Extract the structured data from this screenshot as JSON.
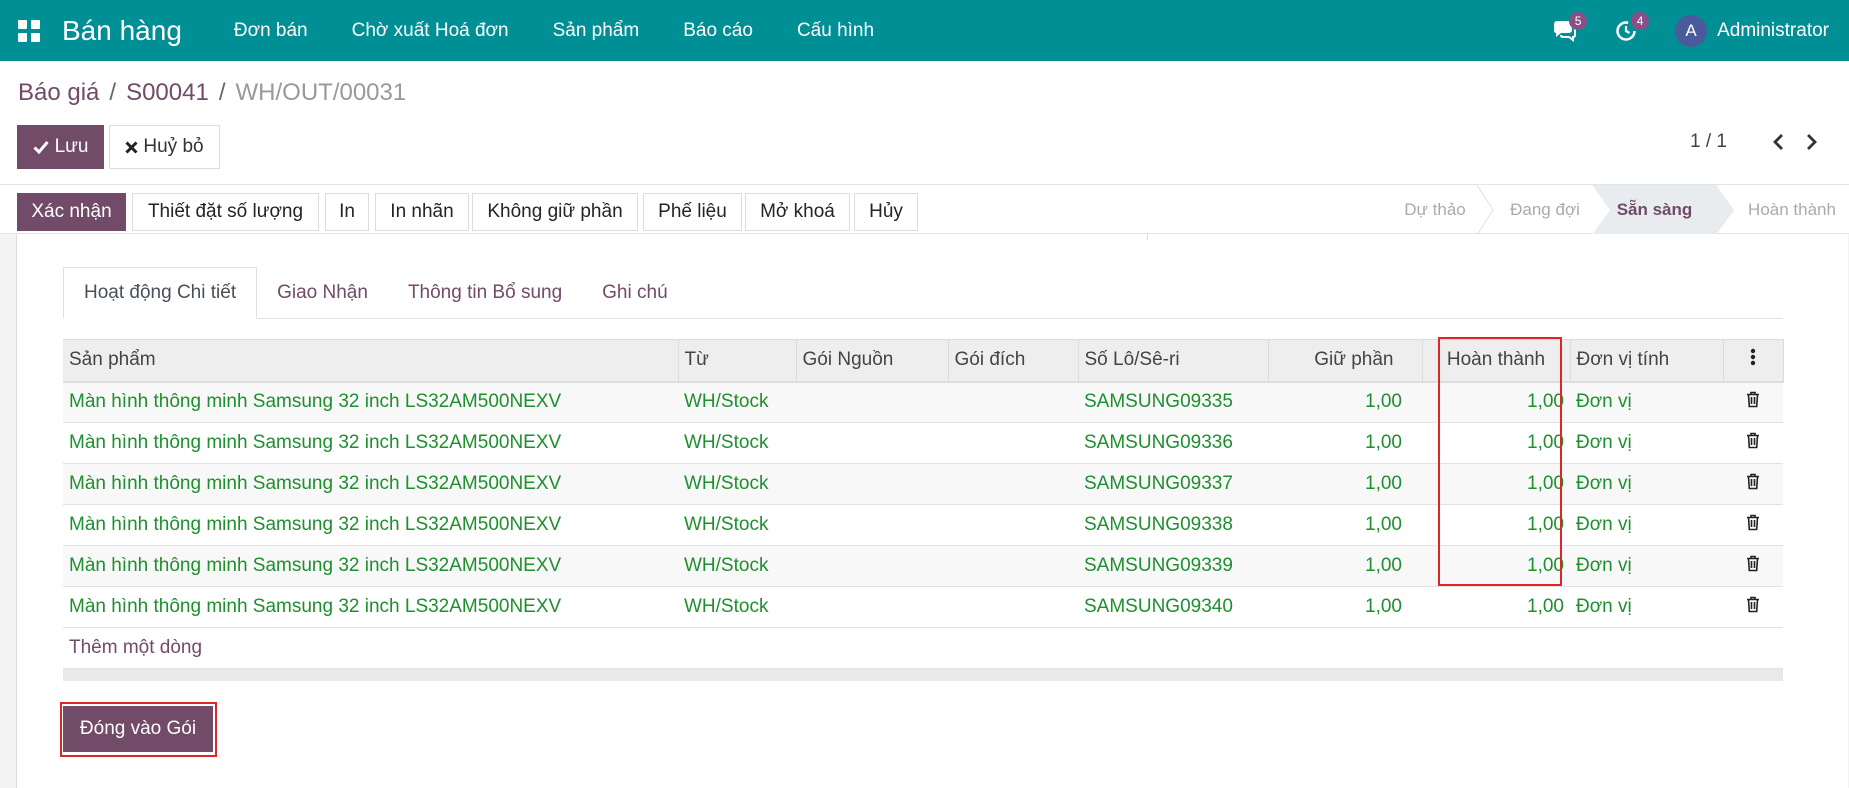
{
  "navbar": {
    "app_title": "Bán hàng",
    "menu": [
      "Đơn bán",
      "Chờ xuất Hoá đơn",
      "Sản phẩm",
      "Báo cáo",
      "Cấu hình"
    ],
    "messages_count": "5",
    "activities_count": "4",
    "user_initial": "A",
    "user_name": "Administrator"
  },
  "breadcrumb": {
    "items": [
      "Báo giá",
      "S00041"
    ],
    "current": "WH/OUT/00031",
    "separator": "/"
  },
  "control": {
    "save_label": "Lưu",
    "discard_label": "Huỷ bỏ",
    "pager_value": "1 / 1"
  },
  "statusbar": {
    "actions": [
      "Xác nhận",
      "Thiết đặt số lượng",
      "In",
      "In nhãn",
      "Không giữ phần",
      "Phế liệu",
      "Mở khoá",
      "Hủy"
    ],
    "stages": [
      "Dự thảo",
      "Đang đợi",
      "Sẵn sàng",
      "Hoàn thành"
    ],
    "active_stage": "Sẵn sàng"
  },
  "tabs": [
    "Hoạt động Chi tiết",
    "Giao Nhận",
    "Thông tin Bổ sung",
    "Ghi chú"
  ],
  "table": {
    "columns": [
      "Sản phẩm",
      "Từ",
      "Gói Nguồn",
      "Gói đích",
      "Số Lô/Sê-ri",
      "Giữ phần",
      "Hoàn thành",
      "Đơn vị tính"
    ],
    "rows": [
      {
        "product": "Màn hình thông minh Samsung 32 inch LS32AM500NEXV",
        "from": "WH/Stock",
        "source_pkg": "",
        "dest_pkg": "",
        "lot": "SAMSUNG09335",
        "reserved": "1,00",
        "done": "1,00",
        "uom": "Đơn vị"
      },
      {
        "product": "Màn hình thông minh Samsung 32 inch LS32AM500NEXV",
        "from": "WH/Stock",
        "source_pkg": "",
        "dest_pkg": "",
        "lot": "SAMSUNG09336",
        "reserved": "1,00",
        "done": "1,00",
        "uom": "Đơn vị"
      },
      {
        "product": "Màn hình thông minh Samsung 32 inch LS32AM500NEXV",
        "from": "WH/Stock",
        "source_pkg": "",
        "dest_pkg": "",
        "lot": "SAMSUNG09337",
        "reserved": "1,00",
        "done": "1,00",
        "uom": "Đơn vị"
      },
      {
        "product": "Màn hình thông minh Samsung 32 inch LS32AM500NEXV",
        "from": "WH/Stock",
        "source_pkg": "",
        "dest_pkg": "",
        "lot": "SAMSUNG09338",
        "reserved": "1,00",
        "done": "1,00",
        "uom": "Đơn vị"
      },
      {
        "product": "Màn hình thông minh Samsung 32 inch LS32AM500NEXV",
        "from": "WH/Stock",
        "source_pkg": "",
        "dest_pkg": "",
        "lot": "SAMSUNG09339",
        "reserved": "1,00",
        "done": "1,00",
        "uom": "Đơn vị"
      },
      {
        "product": "Màn hình thông minh Samsung 32 inch LS32AM500NEXV",
        "from": "WH/Stock",
        "source_pkg": "",
        "dest_pkg": "",
        "lot": "SAMSUNG09340",
        "reserved": "1,00",
        "done": "1,00",
        "uom": "Đơn vị"
      }
    ],
    "add_line_label": "Thêm một dòng"
  },
  "put_in_pack_label": "Đóng vào Gói",
  "colors": {
    "navbar": "#018f96",
    "primary": "#714b67",
    "row_text": "#1e8f2e",
    "highlight": "#dd2626"
  }
}
